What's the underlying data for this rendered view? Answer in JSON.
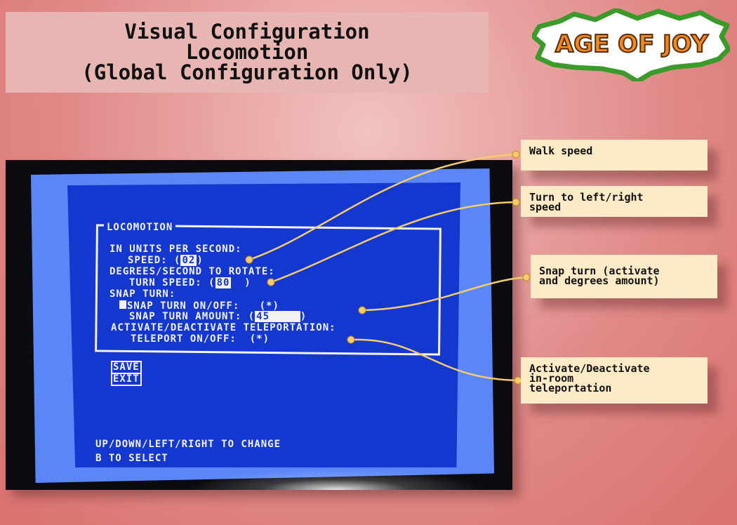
{
  "title": {
    "line1": "Visual Configuration",
    "line2": "Locomotion",
    "line3": "(Global Configuration Only)"
  },
  "logo": {
    "text": "AGE OF JOY"
  },
  "screen": {
    "section_title": "LOCOMOTION",
    "speed_header": "IN UNITS PER SECOND:",
    "speed_label": "SPEED: ",
    "speed_value": "02",
    "rotate_header": "DEGREES/SECOND TO ROTATE:",
    "turn_speed_label": "TURN SPEED: ",
    "turn_speed_value": "80",
    "snap_header": "SNAP TURN:",
    "snap_onoff_label": "SNAP TURN ON/OFF:",
    "snap_onoff_value": "(*)",
    "snap_amount_label": "SNAP TURN AMOUNT: ",
    "snap_amount_value": "45",
    "teleport_header": "ACTIVATE/DEACTIVATE TELEPORTATION:",
    "teleport_label": "TELEPORT ON/OFF:",
    "teleport_value": "(*)",
    "save": "SAVE",
    "exit": "EXIT",
    "help_line1": "UP/DOWN/LEFT/RIGHT TO CHANGE",
    "help_line2": "B TO SELECT"
  },
  "callouts": {
    "walk_speed": "Walk speed",
    "turn_speed": "Turn to left/right\nspeed",
    "snap_turn": "Snap turn (activate\nand degrees amount)",
    "teleport": "Activate/Deactivate\nin-room\nteleportation"
  },
  "colors": {
    "background": "#e08886",
    "screen_blue": "#1438cf",
    "border_blue": "#5b86f8",
    "callout_bg": "#fcebc6",
    "connector": "#f5cc6a",
    "logo_green": "#3a9a2a",
    "logo_orange": "#f08a1a"
  }
}
